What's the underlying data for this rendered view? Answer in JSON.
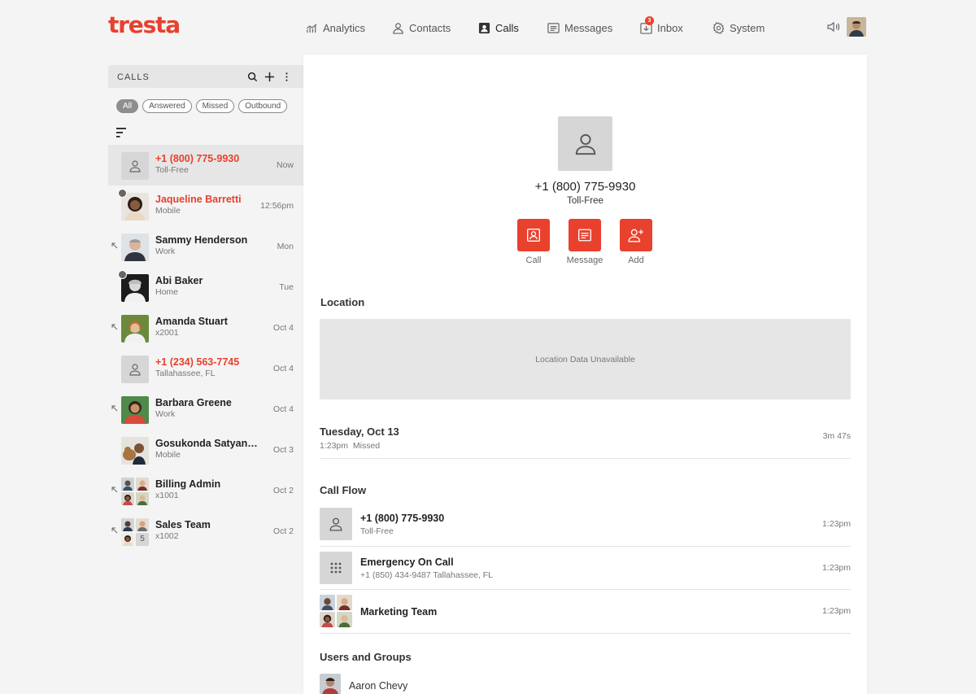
{
  "app": {
    "logo_text": "tresta",
    "brand_color": "#e8412e"
  },
  "nav": {
    "items": [
      {
        "label": "Analytics",
        "icon": "analytics-icon"
      },
      {
        "label": "Contacts",
        "icon": "contacts-icon"
      },
      {
        "label": "Calls",
        "icon": "calls-icon",
        "active": true
      },
      {
        "label": "Messages",
        "icon": "messages-icon"
      },
      {
        "label": "Inbox",
        "icon": "inbox-icon",
        "badge": "3"
      },
      {
        "label": "System",
        "icon": "gear-icon"
      }
    ],
    "speaker_icon": "speaker-icon",
    "profile_icon": "profile-avatar"
  },
  "calls_panel": {
    "title": "CALLS",
    "filters": [
      "All",
      "Answered",
      "Missed",
      "Outbound"
    ],
    "active_filter": "All",
    "items": [
      {
        "name": "+1 (800) 775-9930",
        "sub": "Toll-Free",
        "time": "Now",
        "missed": true,
        "selected": true
      },
      {
        "name": "Jaqueline Barretti",
        "sub": "Mobile",
        "time": "12:56pm",
        "missed": true
      },
      {
        "name": "Sammy Henderson",
        "sub": "Work",
        "time": "Mon",
        "outbound": true
      },
      {
        "name": "Abi Baker",
        "sub": "Home",
        "time": "Tue"
      },
      {
        "name": "Amanda Stuart",
        "sub": "x2001",
        "time": "Oct 4",
        "outbound": true
      },
      {
        "name": "+1 (234) 563-7745",
        "sub": "Tallahassee, FL",
        "time": "Oct 4",
        "missed": true
      },
      {
        "name": "Barbara Greene",
        "sub": "Work",
        "time": "Oct 4",
        "outbound": true
      },
      {
        "name": "Gosukonda Satyanav...",
        "sub": "Mobile",
        "time": "Oct 3"
      },
      {
        "name": "Billing Admin",
        "sub": "x1001",
        "time": "Oct 2",
        "outbound": true
      },
      {
        "name": "Sales Team",
        "sub": "x1002",
        "time": "Oct 2",
        "outbound": true,
        "extra_count": "5"
      }
    ]
  },
  "detail": {
    "number": "+1 (800) 775-9930",
    "number_type": "Toll-Free",
    "actions": [
      "Call",
      "Message",
      "Add"
    ],
    "location": {
      "title": "Location",
      "unavailable_text": "Location Data Unavailable"
    },
    "call_date": "Tuesday, Oct 13",
    "call_time": "1:23pm",
    "call_status": "Missed",
    "duration": "3m 47s",
    "call_flow": {
      "title": "Call Flow",
      "steps": [
        {
          "name": "+1 (800) 775-9930",
          "sub": "Toll-Free",
          "time": "1:23pm"
        },
        {
          "name": "Emergency On Call",
          "sub": "+1 (850) 434-9487  Tallahassee, FL",
          "time": "1:23pm"
        },
        {
          "name": "Marketing Team",
          "sub": "",
          "time": "1:23pm"
        }
      ]
    },
    "users_groups": {
      "title": "Users and Groups",
      "users": [
        "Aaron Chevy"
      ]
    }
  }
}
